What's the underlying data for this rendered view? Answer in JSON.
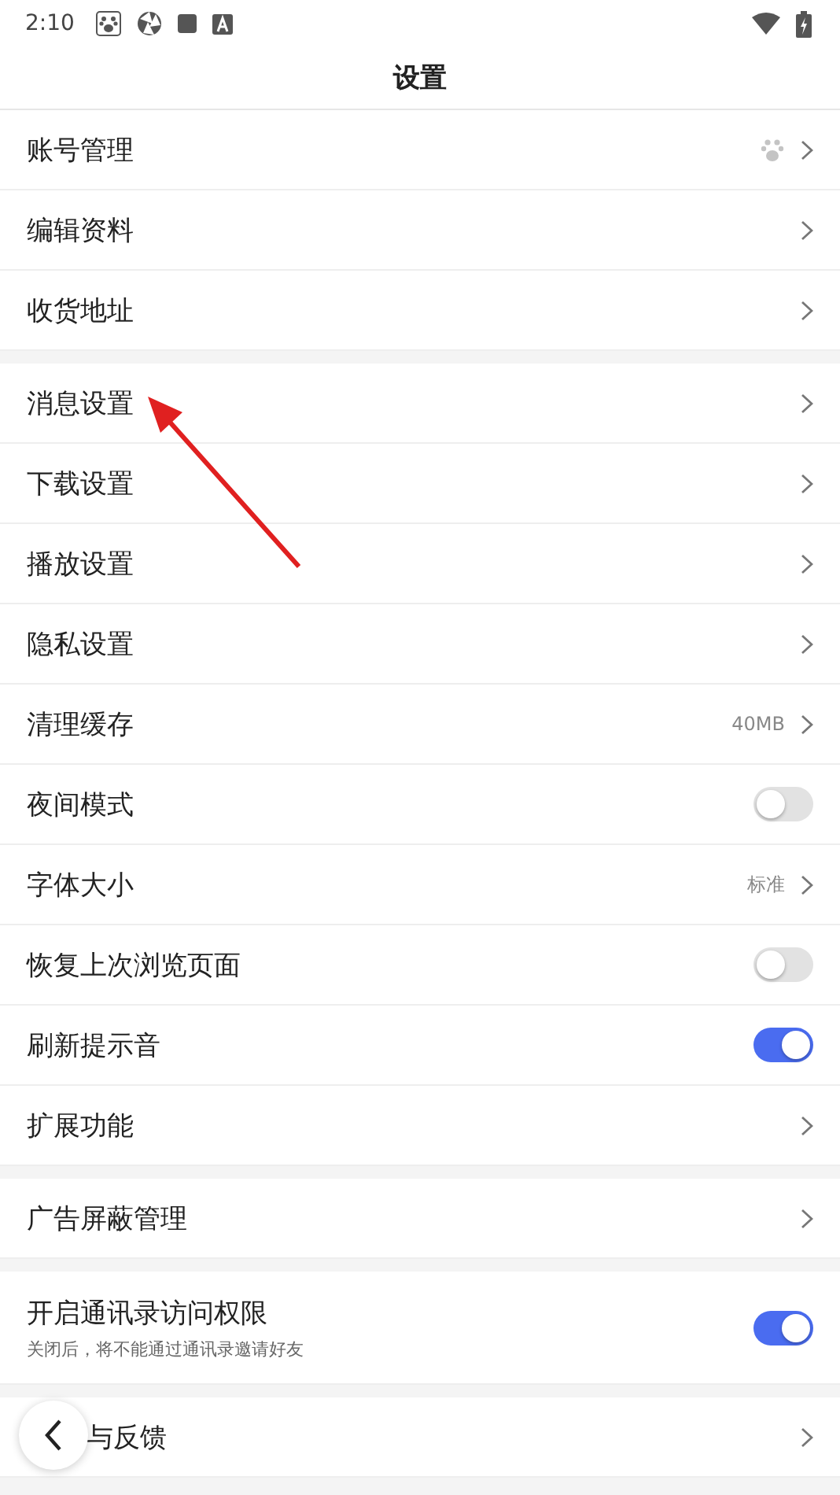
{
  "status_bar": {
    "time": "2:10"
  },
  "header": {
    "title": "设置"
  },
  "sections": [
    {
      "rows": [
        {
          "kind": "account",
          "label": "账号管理"
        },
        {
          "kind": "link",
          "label": "编辑资料"
        },
        {
          "kind": "link",
          "label": "收货地址"
        }
      ]
    },
    {
      "rows": [
        {
          "kind": "link",
          "label": "消息设置"
        },
        {
          "kind": "link",
          "label": "下载设置"
        },
        {
          "kind": "link",
          "label": "播放设置"
        },
        {
          "kind": "link",
          "label": "隐私设置"
        },
        {
          "kind": "link",
          "label": "清理缓存",
          "value": "40MB"
        },
        {
          "kind": "toggle",
          "label": "夜间模式",
          "on": false
        },
        {
          "kind": "link",
          "label": "字体大小",
          "value": "标准"
        },
        {
          "kind": "toggle",
          "label": "恢复上次浏览页面",
          "on": false
        },
        {
          "kind": "toggle",
          "label": "刷新提示音",
          "on": true
        },
        {
          "kind": "link",
          "label": "扩展功能"
        }
      ]
    },
    {
      "rows": [
        {
          "kind": "link",
          "label": "广告屏蔽管理"
        }
      ]
    },
    {
      "rows": [
        {
          "kind": "toggle",
          "label": "开启通讯录访问权限",
          "subtitle": "关闭后，将不能通过通讯录邀请好友",
          "on": true
        }
      ]
    },
    {
      "rows": [
        {
          "kind": "link",
          "label": "与反馈",
          "under_back_button": true
        }
      ]
    }
  ]
}
